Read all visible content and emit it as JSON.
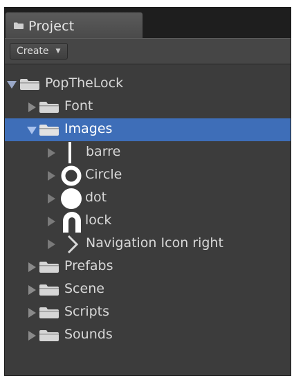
{
  "tab": {
    "title": "Project",
    "icon": "folder-icon"
  },
  "toolbar": {
    "create_label": "Create",
    "create_caret": "▼"
  },
  "tree": {
    "root": {
      "label": "PopTheLock",
      "expanded": true
    },
    "items": [
      {
        "label": "Font",
        "type": "folder",
        "expanded": false
      },
      {
        "label": "Images",
        "type": "folder",
        "expanded": true,
        "selected": true
      },
      {
        "label": "barre",
        "type": "sprite",
        "icon": "bar-icon"
      },
      {
        "label": "Circle",
        "type": "sprite",
        "icon": "ring-icon"
      },
      {
        "label": "dot",
        "type": "sprite",
        "icon": "dot-icon"
      },
      {
        "label": "lock",
        "type": "sprite",
        "icon": "lock-shackle-icon"
      },
      {
        "label": "Navigation Icon right",
        "type": "sprite",
        "icon": "chevron-right-icon"
      },
      {
        "label": "Prefabs",
        "type": "folder",
        "expanded": false
      },
      {
        "label": "Scene",
        "type": "folder",
        "expanded": false
      },
      {
        "label": "Scripts",
        "type": "folder",
        "expanded": false
      },
      {
        "label": "Sounds",
        "type": "folder",
        "expanded": false
      }
    ]
  },
  "colors": {
    "panel": "#3c3c3c",
    "selection": "#3e6eb8",
    "folder": "#d6d6d6",
    "text": "#d8d8d8"
  }
}
